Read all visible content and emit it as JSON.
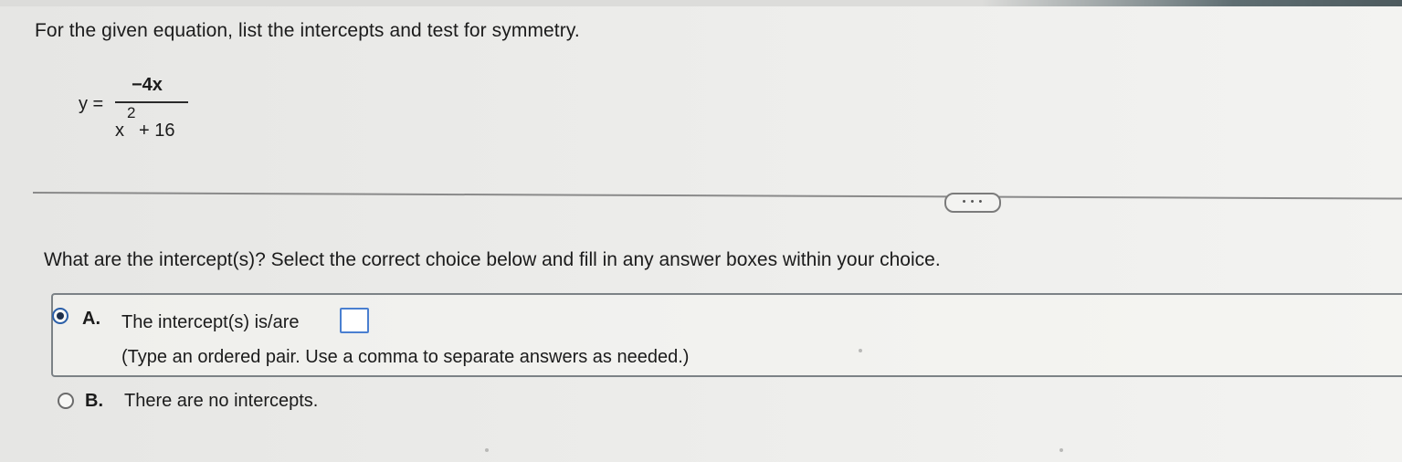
{
  "problem": {
    "instruction": "For the given equation, list the intercepts and test for symmetry.",
    "equation": {
      "lhs": "y =",
      "numerator": "−4x",
      "denominator_base": "x",
      "denominator_exponent": "2",
      "denominator_rest": "+ 16"
    }
  },
  "more_button": {
    "label": "• • •"
  },
  "question": {
    "text": "What are the intercept(s)? Select the correct choice below and fill in any answer boxes within your choice."
  },
  "choices": [
    {
      "letter": "A.",
      "text": "The intercept(s) is/are",
      "hint": "(Type an ordered pair. Use a comma to separate answers as needed.)",
      "selected": true,
      "answer_value": ""
    },
    {
      "letter": "B.",
      "text": "There are no intercepts.",
      "selected": false
    }
  ],
  "colors": {
    "selected_radio": "#1e2f4a",
    "answer_box_border": "#4a7fd0"
  }
}
